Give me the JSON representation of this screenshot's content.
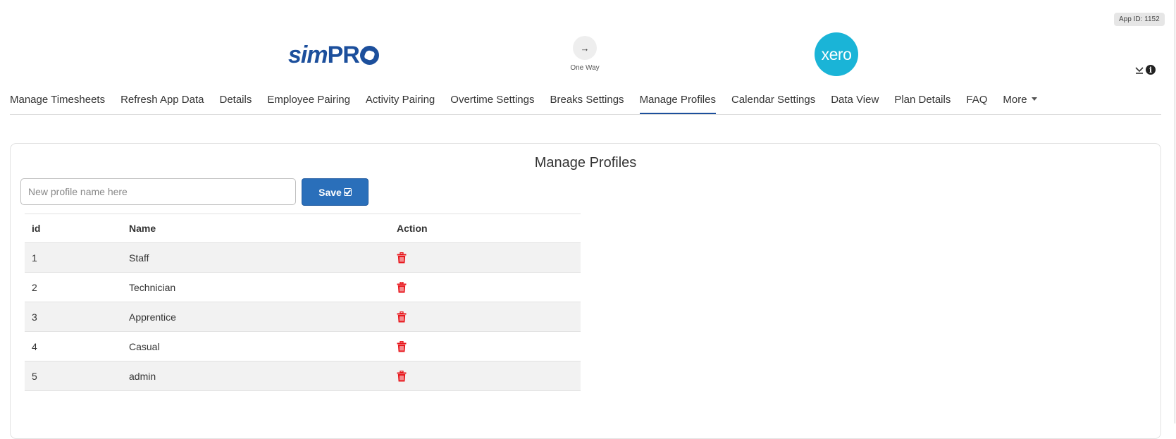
{
  "header": {
    "app_id": "App ID: 1152",
    "source_logo": "simPRO",
    "source_logo_parts": {
      "italic": "sim",
      "bold": "PR"
    },
    "direction": {
      "icon": "arrow-right-icon",
      "glyph": "→",
      "label": "One Way"
    },
    "target_logo": "xero",
    "icons": [
      "download-icon",
      "info-icon"
    ]
  },
  "nav": {
    "items": [
      {
        "label": "Manage Timesheets",
        "active": false
      },
      {
        "label": "Refresh App Data",
        "active": false
      },
      {
        "label": "Details",
        "active": false
      },
      {
        "label": "Employee Pairing",
        "active": false
      },
      {
        "label": "Activity Pairing",
        "active": false
      },
      {
        "label": "Overtime Settings",
        "active": false
      },
      {
        "label": "Breaks Settings",
        "active": false
      },
      {
        "label": "Manage Profiles",
        "active": true
      },
      {
        "label": "Calendar Settings",
        "active": false
      },
      {
        "label": "Data View",
        "active": false
      },
      {
        "label": "Plan Details",
        "active": false
      },
      {
        "label": "FAQ",
        "active": false
      },
      {
        "label": "More",
        "active": false,
        "has_dropdown": true
      }
    ]
  },
  "main": {
    "title": "Manage Profiles",
    "input": {
      "value": "",
      "placeholder": "New profile name here"
    },
    "save_label": "Save",
    "table": {
      "columns": [
        "id",
        "Name",
        "Action"
      ],
      "rows": [
        {
          "id": "1",
          "name": "Staff",
          "action": "delete"
        },
        {
          "id": "2",
          "name": "Technician",
          "action": "delete"
        },
        {
          "id": "3",
          "name": "Apprentice",
          "action": "delete"
        },
        {
          "id": "4",
          "name": "Casual",
          "action": "delete"
        },
        {
          "id": "5",
          "name": "admin",
          "action": "delete"
        }
      ]
    }
  },
  "colors": {
    "accent": "#1c4f9c",
    "save_button": "#2a6fba",
    "xero": "#1ab4d7",
    "delete": "#e8191f",
    "row_shade": "#f2f2f2"
  }
}
